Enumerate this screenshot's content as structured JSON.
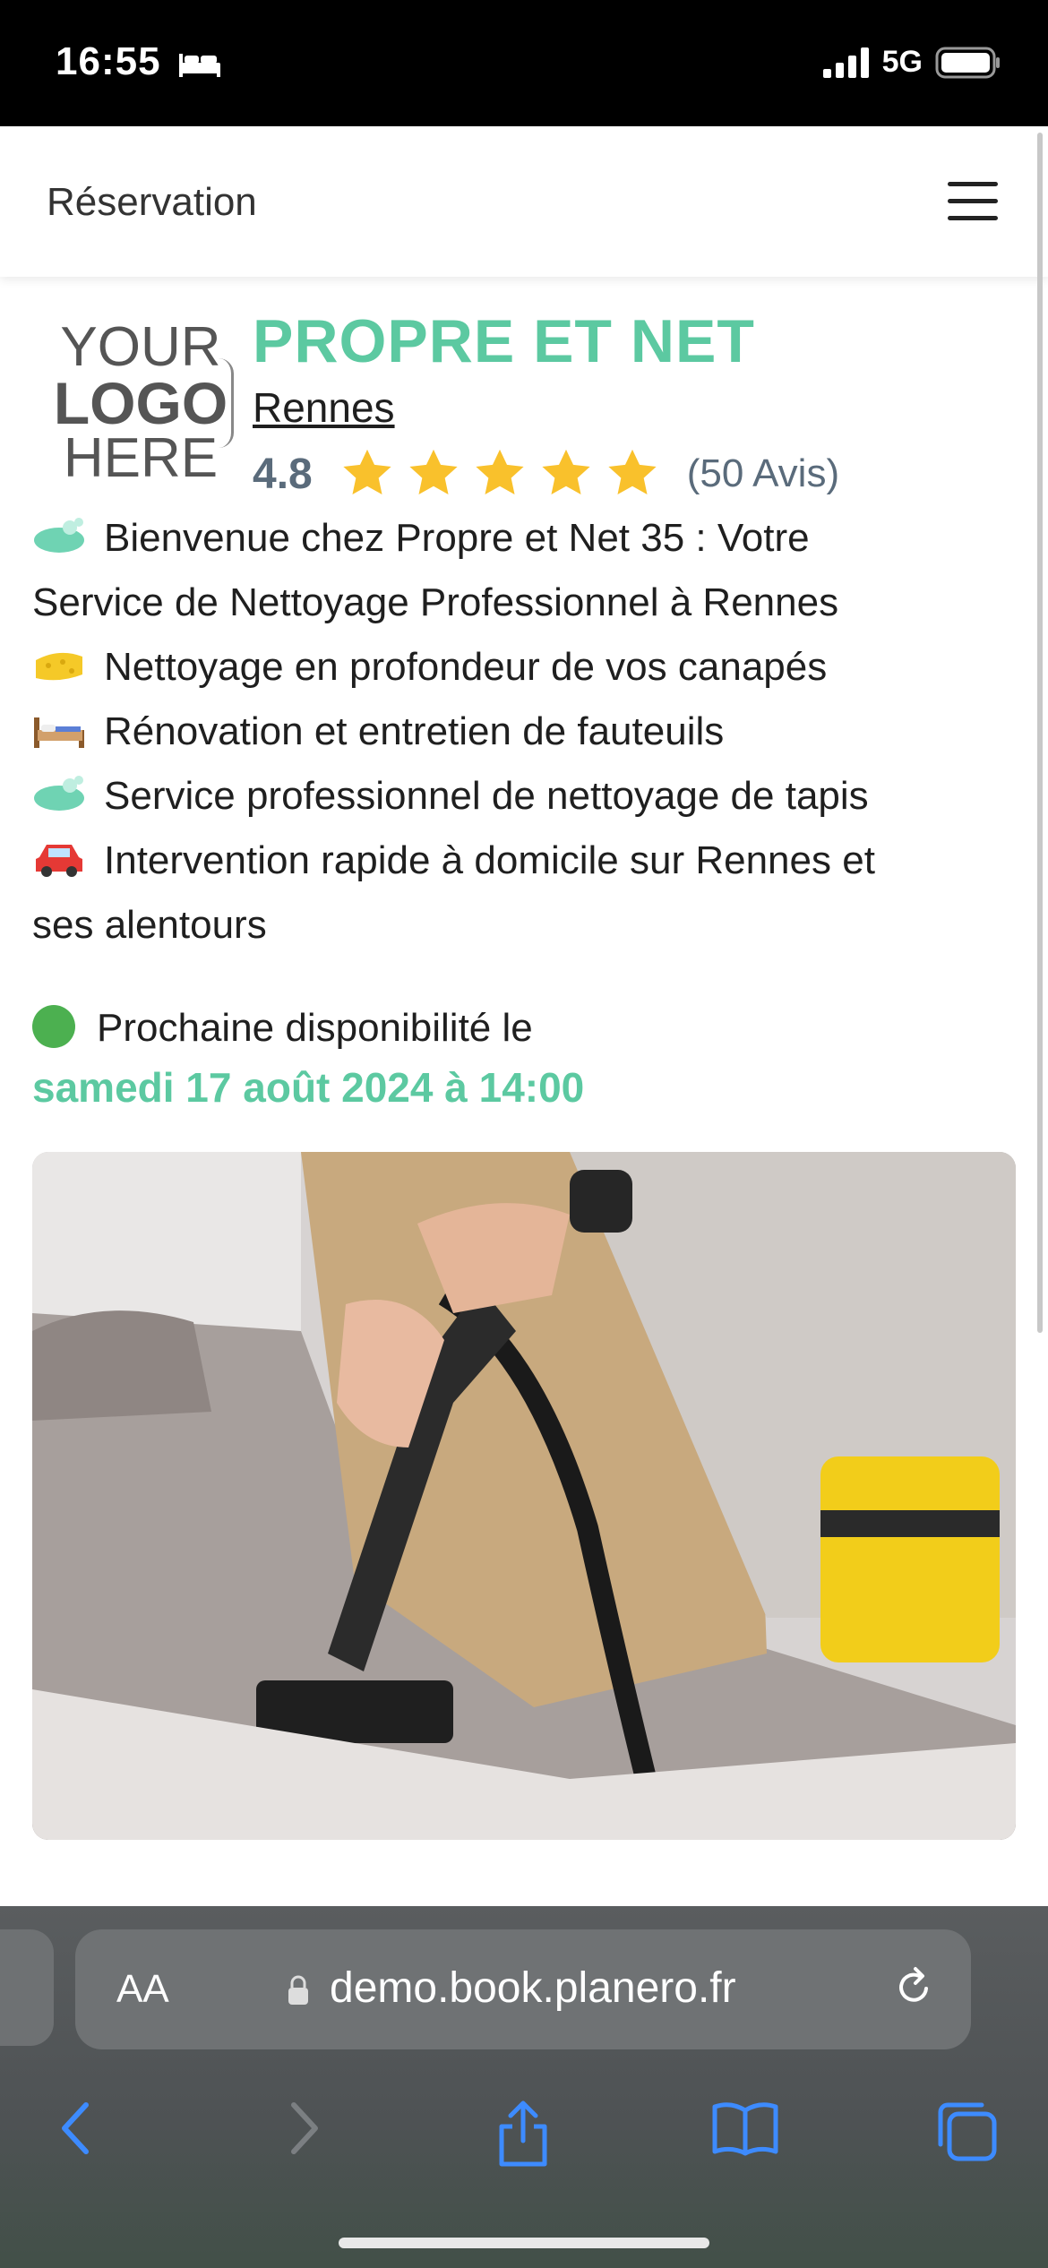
{
  "status_bar": {
    "time": "16:55",
    "network": "5G"
  },
  "header": {
    "title": "Réservation"
  },
  "business": {
    "logo": {
      "line1": "YOUR",
      "line2": "LOGO",
      "line3": "HERE"
    },
    "name": "PROPRE ET NET",
    "city": "Rennes",
    "rating": "4.8",
    "stars": 5,
    "reviews": "(50 Avis)"
  },
  "description": [
    {
      "icon": "soap-icon",
      "text": "Bienvenue chez Propre et Net 35 : Votre"
    },
    {
      "icon": "",
      "text": "Service de Nettoyage Professionnel à Rennes"
    },
    {
      "icon": "sponge-icon",
      "text": "Nettoyage en profondeur de vos canapés"
    },
    {
      "icon": "bed-icon",
      "text": "Rénovation et entretien de fauteuils"
    },
    {
      "icon": "soap-icon",
      "text": "Service professionnel de nettoyage de tapis"
    },
    {
      "icon": "car-icon",
      "text": "Intervention rapide à domicile sur Rennes et"
    },
    {
      "icon": "",
      "text": "ses alentours"
    }
  ],
  "availability": {
    "label": "Prochaine disponibilité le",
    "date": "samedi 17 août 2024 à 14:00",
    "status_color": "#4cb050"
  },
  "colors": {
    "accent": "#5cc9a1",
    "rating": "#5a6b7b",
    "star": "#f9c12c"
  },
  "browser": {
    "aa_label": "AA",
    "url": "demo.book.planero.fr"
  }
}
